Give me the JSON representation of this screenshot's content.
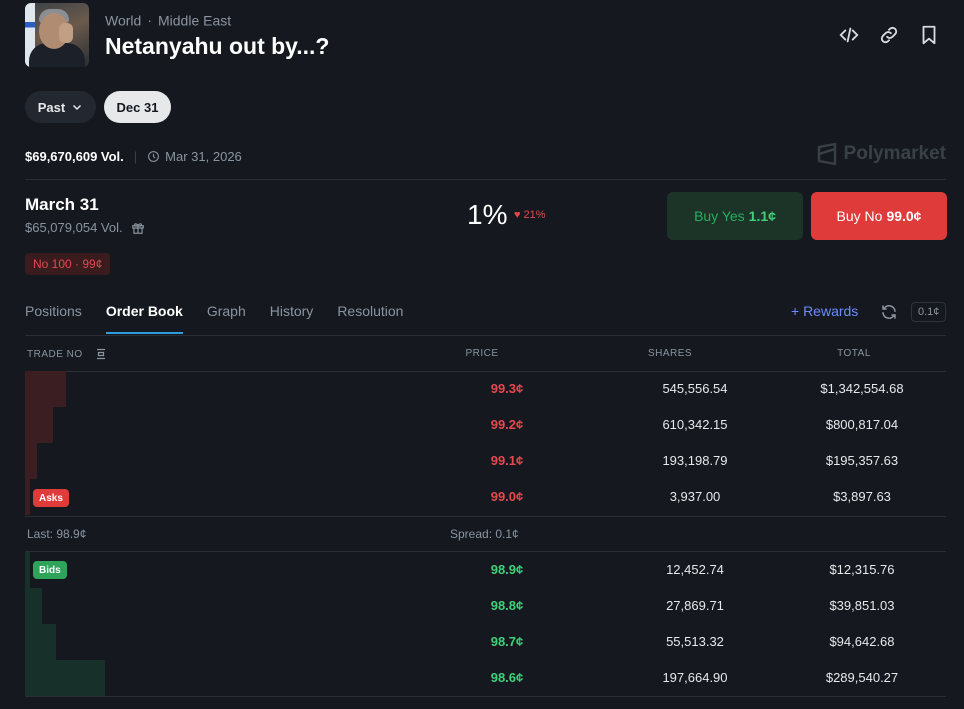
{
  "breadcrumb": {
    "category": "World",
    "subcategory": "Middle East"
  },
  "event_title": "Netanyahu out by...?",
  "date_filter": {
    "past_label": "Past",
    "selected_label": "Dec 31"
  },
  "event_meta": {
    "volume": "$69,670,609 Vol.",
    "end_date": "Mar 31, 2026",
    "brand": "Polymarket"
  },
  "market": {
    "title": "March 31",
    "volume": "$65,079,054 Vol.",
    "position_badge": "No 100 · 99¢",
    "probability": "1%",
    "change": "21%",
    "buy_yes_label": "Buy Yes",
    "buy_yes_price": "1.1¢",
    "buy_no_label": "Buy No",
    "buy_no_price": "99.0¢"
  },
  "tabs": [
    {
      "label": "Positions"
    },
    {
      "label": "Order Book",
      "active": true
    },
    {
      "label": "Graph"
    },
    {
      "label": "History"
    },
    {
      "label": "Resolution"
    }
  ],
  "rewards_label": "+ Rewards",
  "tick_size": "0.1¢",
  "table": {
    "headers": {
      "trade": "TRADE NO",
      "price": "PRICE",
      "shares": "SHARES",
      "total": "TOTAL"
    },
    "asks_label": "Asks",
    "bids_label": "Bids",
    "asks": [
      {
        "price": "99.3¢",
        "shares": "545,556.54",
        "total": "$1,342,554.68",
        "depth": 0.044
      },
      {
        "price": "99.2¢",
        "shares": "610,342.15",
        "total": "$800,817.04",
        "depth": 0.03
      },
      {
        "price": "99.1¢",
        "shares": "193,198.79",
        "total": "$195,357.63",
        "depth": 0.013
      },
      {
        "price": "99.0¢",
        "shares": "3,937.00",
        "total": "$3,897.63",
        "depth": 0.005
      }
    ],
    "last": "Last: 98.9¢",
    "spread": "Spread: 0.1¢",
    "bids": [
      {
        "price": "98.9¢",
        "shares": "12,452.74",
        "total": "$12,315.76",
        "depth": 0.005
      },
      {
        "price": "98.8¢",
        "shares": "27,869.71",
        "total": "$39,851.03",
        "depth": 0.018
      },
      {
        "price": "98.7¢",
        "shares": "55,513.32",
        "total": "$94,642.68",
        "depth": 0.034
      },
      {
        "price": "98.6¢",
        "shares": "197,664.90",
        "total": "$289,540.27",
        "depth": 0.087
      }
    ]
  },
  "colors": {
    "background": "#15191f",
    "ask_red": "#e5484d",
    "bid_green": "#3fd17a",
    "accent_blue": "#2d9cdb"
  },
  "icons": [
    "embed-icon",
    "link-icon",
    "bookmark-icon",
    "clock-icon",
    "gift-icon",
    "refresh-icon",
    "chevron-down-icon",
    "heart-icon",
    "sort-icon"
  ]
}
